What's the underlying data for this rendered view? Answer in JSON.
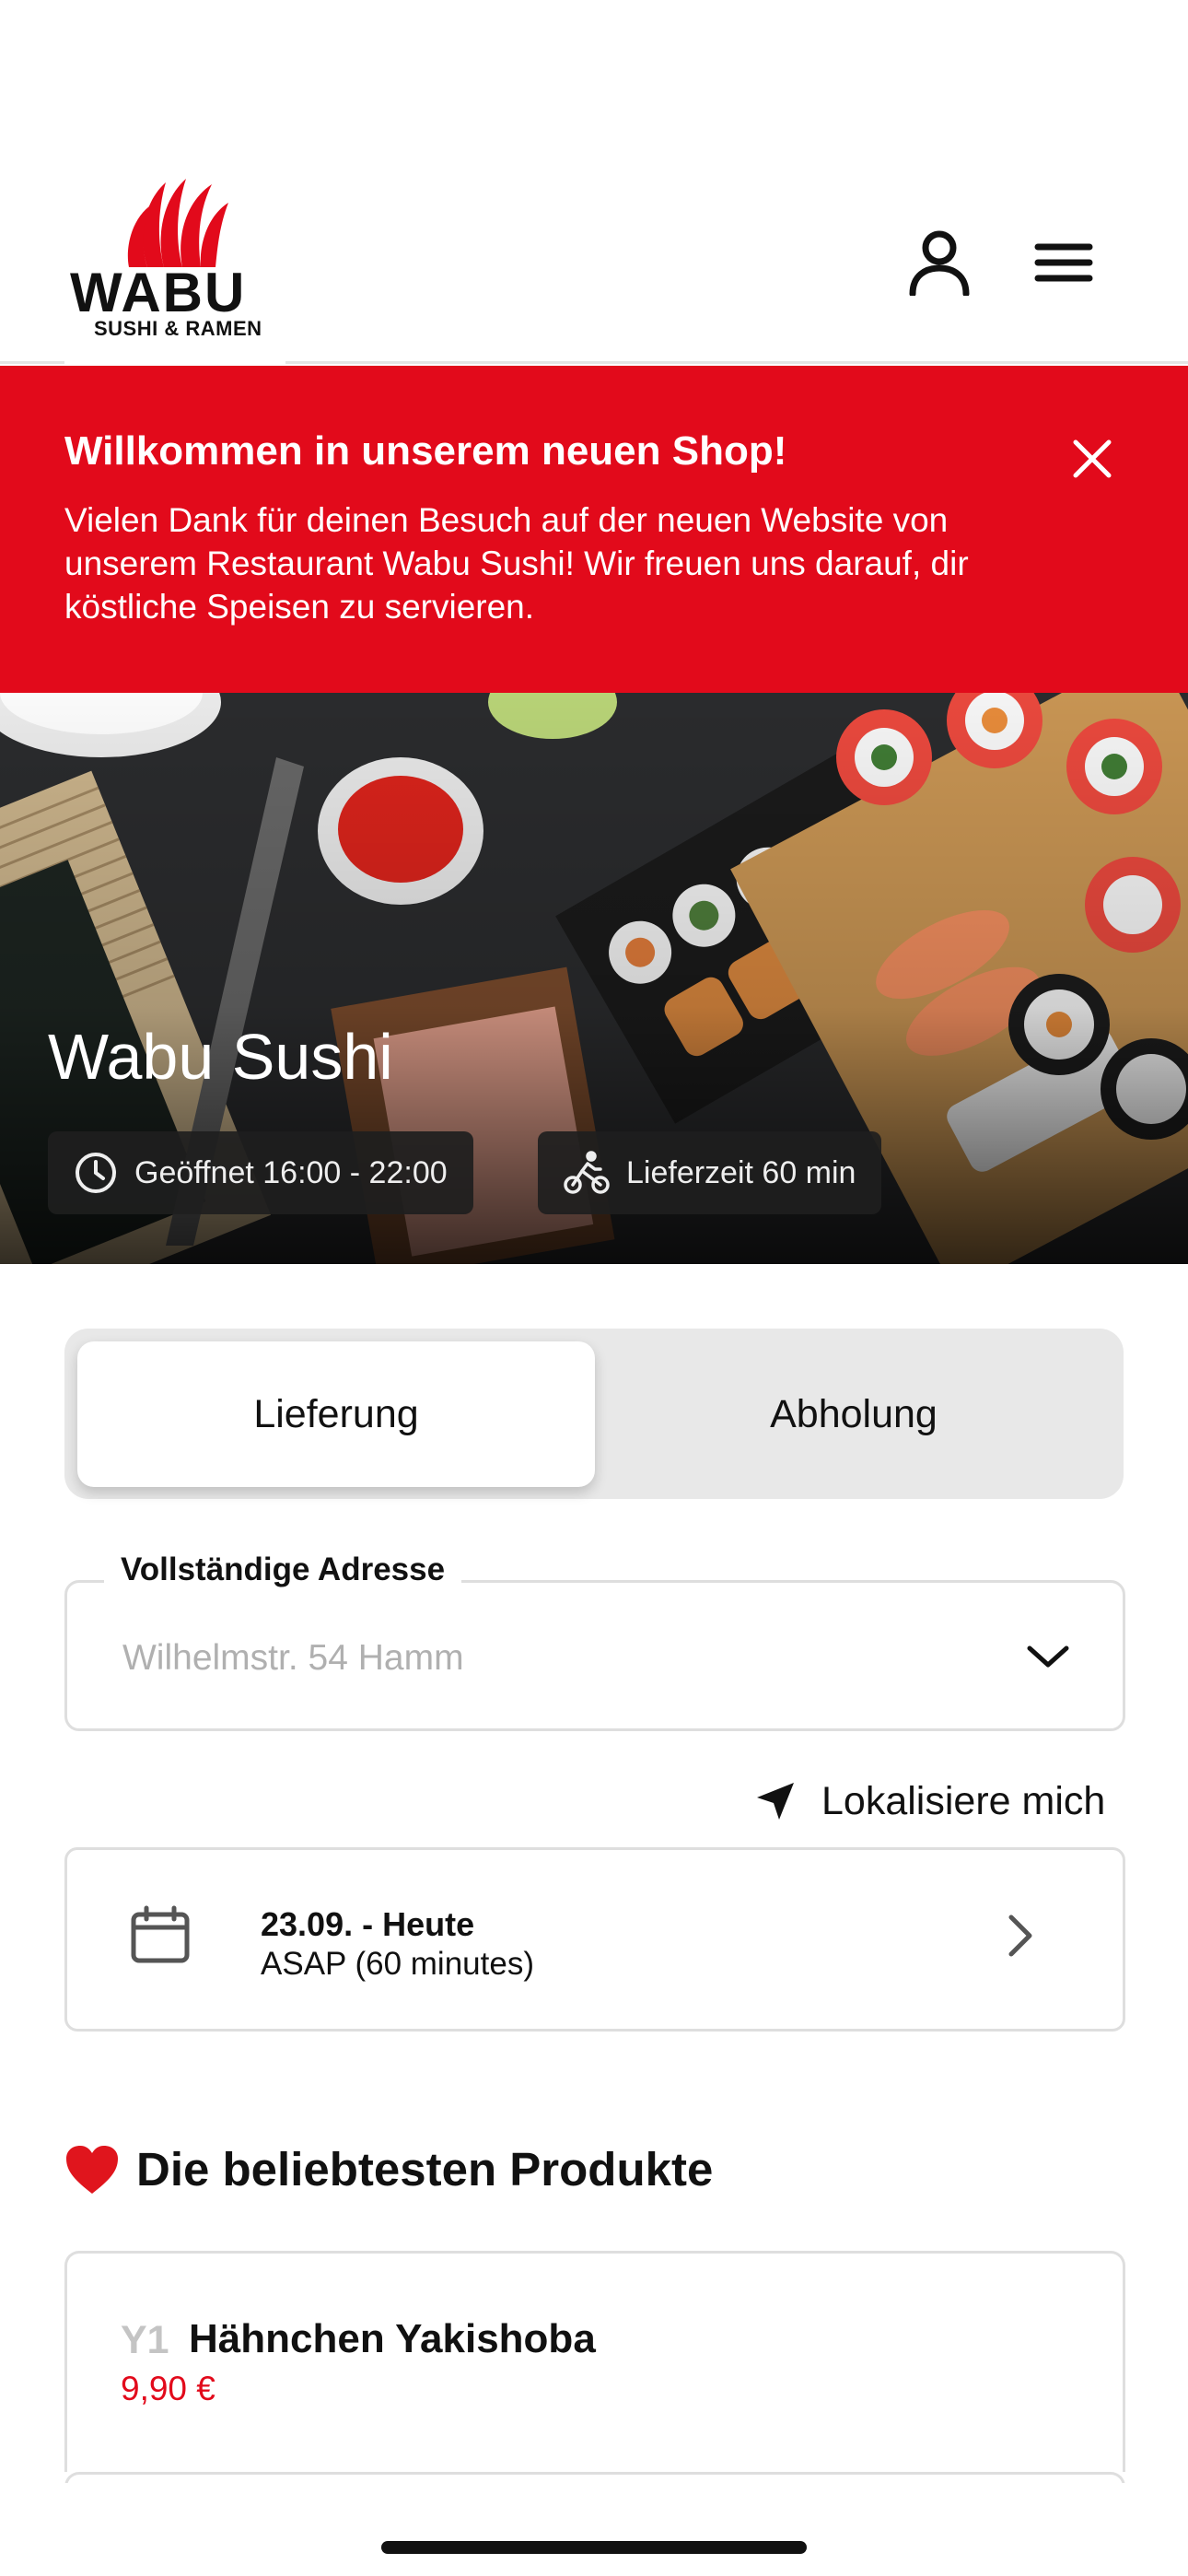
{
  "header": {
    "logo_word": "WABU",
    "logo_sub": "SUSHI & RAMEN",
    "brand_color": "#e20a1b",
    "account_icon": "user-icon",
    "menu_icon": "hamburger-icon"
  },
  "banner": {
    "title": "Willkommen in unserem neuen Shop!",
    "text": "Vielen Dank für deinen Besuch auf der neuen Website von unserem Restaurant Wabu Sushi! Wir freuen uns darauf, dir köstliche Speisen zu servieren.",
    "close_icon": "close-icon"
  },
  "hero": {
    "title": "Wabu Sushi",
    "opening": "Geöffnet 16:00 - 22:00",
    "delivery_time": "Lieferzeit 60 min"
  },
  "order_mode": {
    "options": [
      "Lieferung",
      "Abholung"
    ],
    "selected": "Lieferung"
  },
  "address": {
    "label": "Vollständige Adresse",
    "placeholder": "Wilhelmstr. 54 Hamm"
  },
  "locate": {
    "label": "Lokalisiere mich"
  },
  "schedule": {
    "date": "23.09. - Heute",
    "time": "ASAP (60 minutes)"
  },
  "popular": {
    "emoji": "❤️",
    "title": "Die beliebtesten Produkte",
    "items": [
      {
        "code": "Y1",
        "name": "Hähnchen Yakishoba",
        "price": "9,90 €"
      }
    ]
  }
}
